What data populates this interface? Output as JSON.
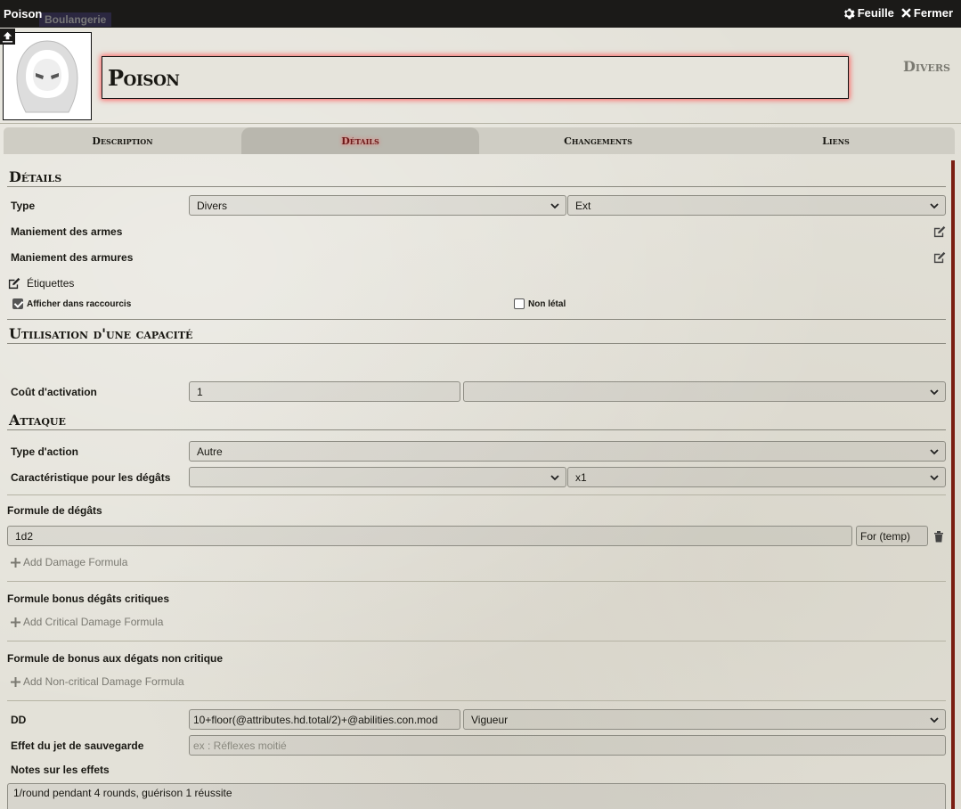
{
  "titlebar": {
    "title": "Poison",
    "background_label": "Boulangerie",
    "sheet_label": "Feuille",
    "close_label": "Fermer"
  },
  "header": {
    "name": "Poison",
    "item_type": "Divers"
  },
  "tabs": [
    {
      "label": "Description",
      "active": false
    },
    {
      "label": "Détails",
      "active": true
    },
    {
      "label": "Changements",
      "active": false
    },
    {
      "label": "Liens",
      "active": false
    }
  ],
  "details": {
    "section_title": "Détails",
    "type_label": "Type",
    "type_value": "Divers",
    "subtype_value": "Ext",
    "weapon_prof_label": "Maniement des armes",
    "armor_prof_label": "Maniement des armures",
    "tags_label": "Étiquettes",
    "show_in_quickbar_label": "Afficher dans raccourcis",
    "show_in_quickbar_checked": true,
    "nonlethal_label": "Non létal",
    "nonlethal_checked": false
  },
  "activation": {
    "section_title": "Utilisation d'une capacité",
    "cost_label": "Coût d'activation",
    "cost_value": "1",
    "cost_type_value": ""
  },
  "attack": {
    "section_title": "Attaque",
    "action_type_label": "Type d'action",
    "action_type_value": "Autre",
    "damage_ability_label": "Caractéristique pour les dégâts",
    "damage_ability_value": "",
    "damage_mult_value": "x1",
    "damage_formula_label": "Formule de dégâts",
    "damage_formula_value": "1d2",
    "damage_type_value": "For (temp)",
    "add_damage_label": "Add Damage Formula",
    "crit_formula_label": "Formule bonus dégâts critiques",
    "add_crit_label": "Add Critical Damage Formula",
    "noncrit_formula_label": "Formule de bonus aux dégats non critique",
    "add_noncrit_label": "Add Non-critical Damage Formula"
  },
  "save": {
    "dc_label": "DD",
    "dc_value": "10+floor(@attributes.hd.total/2)+@abilities.con.mod",
    "save_type_value": "Vigueur",
    "save_effect_label": "Effet du jet de sauvegarde",
    "save_effect_placeholder": "ex : Réflexes moitié",
    "effect_notes_label": "Notes sur les effets",
    "effect_notes_value": "1/round pendant 4 rounds, guérison 1 réussite"
  },
  "colors": {
    "accent": "#ff5a5a",
    "scrollbar": "#7a1e12",
    "parchment": "#e3e1d8"
  }
}
